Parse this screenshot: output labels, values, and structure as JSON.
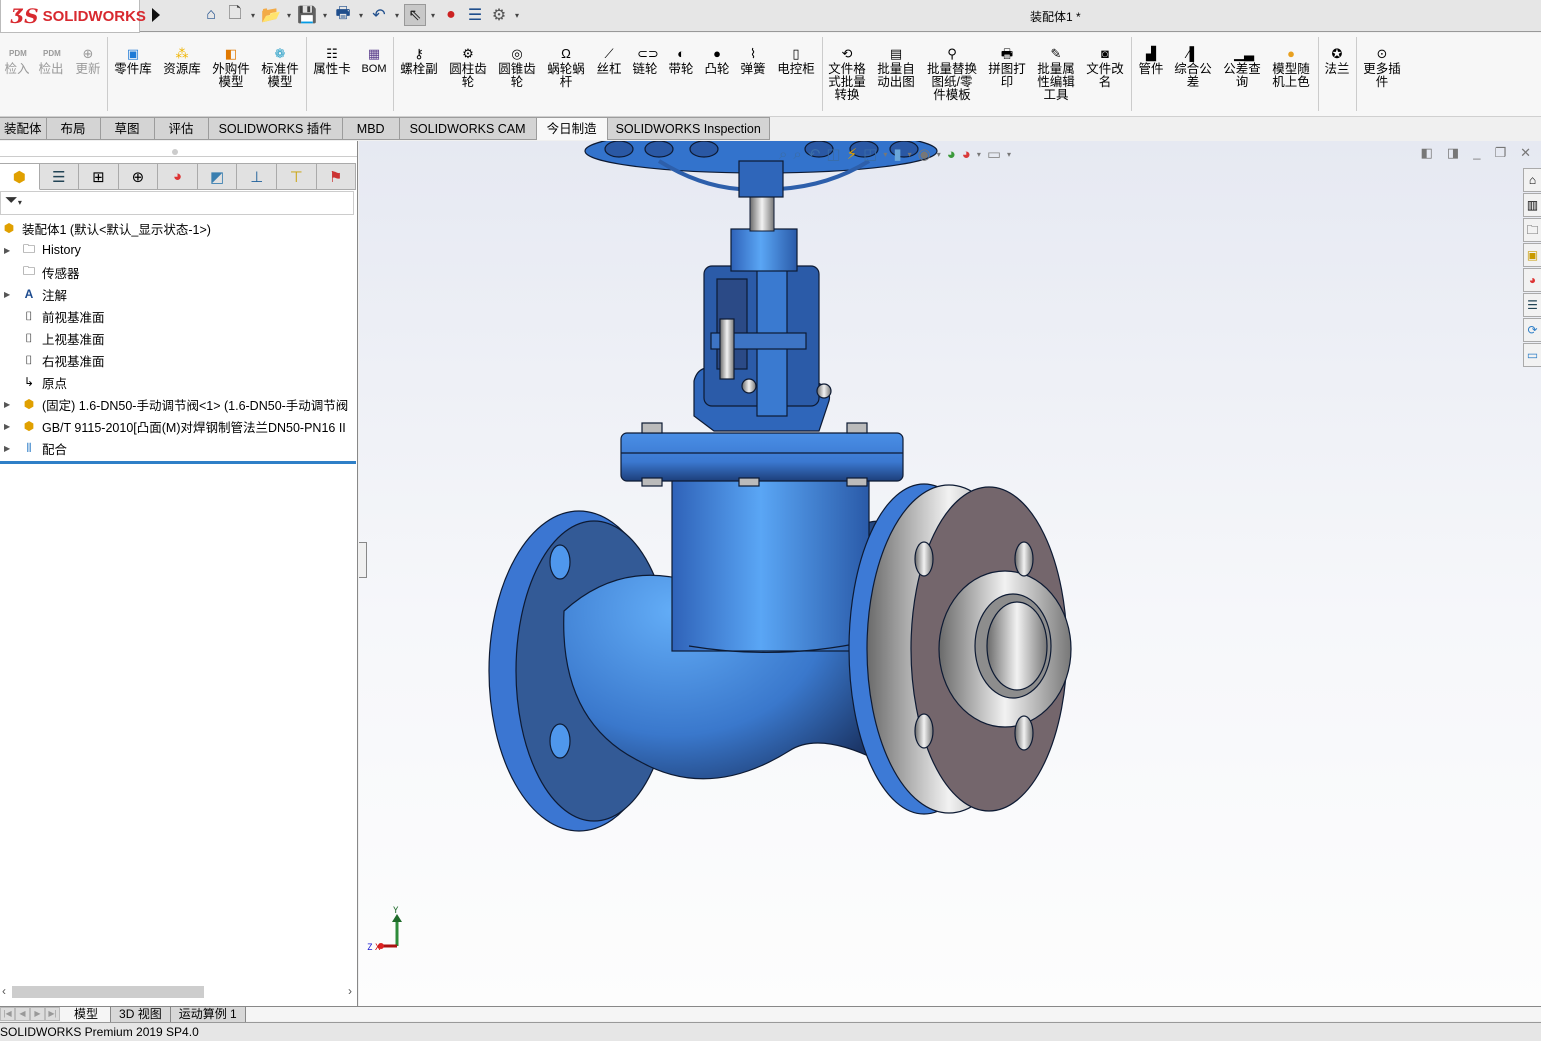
{
  "app": {
    "brand": "SOLIDWORKS",
    "brand_prefix": "3S",
    "document_title": "装配体1 *"
  },
  "quick_access": [
    {
      "icon": "home-icon"
    },
    {
      "icon": "new-document-icon"
    },
    {
      "icon": "open-icon"
    },
    {
      "icon": "save-icon"
    },
    {
      "icon": "print-icon"
    },
    {
      "icon": "undo-icon"
    },
    {
      "icon": "select-arrow-icon"
    },
    {
      "icon": "rebuild-traffic-light-icon"
    },
    {
      "icon": "file-properties-icon"
    },
    {
      "icon": "options-gear-icon"
    }
  ],
  "command_manager": {
    "pdm": [
      {
        "label": "检入",
        "icon": "pdm-checkin-icon",
        "disabled": true
      },
      {
        "label": "检出",
        "icon": "pdm-checkout-icon",
        "disabled": true
      },
      {
        "label": "更新",
        "icon": "pdm-update-icon",
        "disabled": true
      }
    ],
    "library": [
      {
        "label": "零件库",
        "icon": "part-library-icon"
      },
      {
        "label": "资源库",
        "icon": "resource-library-icon"
      },
      {
        "label": "外购件\n模型",
        "icon": "purchased-part-icon"
      },
      {
        "label": "标准件\n模型",
        "icon": "standard-part-icon"
      }
    ],
    "props": [
      {
        "label": "属性卡",
        "icon": "property-card-icon"
      },
      {
        "label": "BOM",
        "icon": "bom-icon"
      }
    ],
    "mechanical": [
      {
        "label": "螺栓副",
        "icon": "bolt-icon"
      },
      {
        "label": "圆柱齿\n轮",
        "icon": "spur-gear-icon"
      },
      {
        "label": "圆锥齿\n轮",
        "icon": "bevel-gear-icon"
      },
      {
        "label": "蜗轮蜗\n杆",
        "icon": "worm-gear-icon"
      },
      {
        "label": "丝杠",
        "icon": "lead-screw-icon"
      },
      {
        "label": "链轮",
        "icon": "sprocket-icon"
      },
      {
        "label": "带轮",
        "icon": "pulley-icon"
      },
      {
        "label": "凸轮",
        "icon": "cam-icon"
      },
      {
        "label": "弹簧",
        "icon": "spring-icon"
      },
      {
        "label": "电控柜",
        "icon": "control-cabinet-icon"
      }
    ],
    "batch": [
      {
        "label": "文件格\n式批量\n转换",
        "icon": "format-convert-icon"
      },
      {
        "label": "批量自\n动出图",
        "icon": "auto-drawing-icon"
      },
      {
        "label": "批量替换\n图纸/零\n件模板",
        "icon": "replace-template-icon"
      },
      {
        "label": "拼图打\n印",
        "icon": "print-tile-icon"
      },
      {
        "label": "批量属\n性编辑\n工具",
        "icon": "batch-property-edit-icon"
      },
      {
        "label": "文件改\n名",
        "icon": "file-rename-icon"
      }
    ],
    "tools": [
      {
        "label": "管件",
        "icon": "pipe-fitting-icon"
      },
      {
        "label": "综合公\n差",
        "icon": "tolerance-icon"
      },
      {
        "label": "公差查\n询",
        "icon": "tolerance-lookup-icon"
      },
      {
        "label": "模型随\n机上色",
        "icon": "random-color-icon"
      }
    ],
    "flange": [
      {
        "label": "法兰",
        "icon": "flange-icon"
      }
    ],
    "more": [
      {
        "label": "更多插\n件",
        "icon": "more-plugins-icon"
      }
    ]
  },
  "tabs": [
    {
      "label": "装配体",
      "active": false
    },
    {
      "label": "布局",
      "active": false
    },
    {
      "label": "草图",
      "active": false
    },
    {
      "label": "评估",
      "active": false
    },
    {
      "label": "SOLIDWORKS 插件",
      "active": false
    },
    {
      "label": "MBD",
      "active": false
    },
    {
      "label": "SOLIDWORKS CAM",
      "active": false
    },
    {
      "label": "今日制造",
      "active": true
    },
    {
      "label": "SOLIDWORKS Inspection",
      "active": false
    }
  ],
  "manager_tabs": [
    {
      "icon": "featuremanager-icon",
      "active": true
    },
    {
      "icon": "propertymanager-icon"
    },
    {
      "icon": "configurationmanager-icon"
    },
    {
      "icon": "dimxpertmanager-icon"
    },
    {
      "icon": "displaymanager-icon"
    },
    {
      "icon": "cam-feature-tree-icon"
    },
    {
      "icon": "cam-operation-tree-icon"
    },
    {
      "icon": "cam-tool-tree-icon"
    },
    {
      "icon": "inspection-icon"
    }
  ],
  "feature_tree": {
    "root": "装配体1  (默认<默认_显示状态-1>)",
    "items": [
      {
        "label": "History",
        "icon": "history-folder-icon",
        "expandable": true
      },
      {
        "label": "传感器",
        "icon": "sensor-folder-icon",
        "expandable": false
      },
      {
        "label": "注解",
        "icon": "annotations-folder-icon",
        "expandable": true
      },
      {
        "label": "前视基准面",
        "icon": "plane-icon",
        "expandable": false
      },
      {
        "label": "上视基准面",
        "icon": "plane-icon",
        "expandable": false
      },
      {
        "label": "右视基准面",
        "icon": "plane-icon",
        "expandable": false
      },
      {
        "label": "原点",
        "icon": "origin-icon",
        "expandable": false
      },
      {
        "label": "(固定) 1.6-DN50-手动调节阀<1> (1.6-DN50-手动调节阀",
        "icon": "subassembly-icon",
        "expandable": true
      },
      {
        "label": "GB/T 9115-2010[凸面(M)对焊钢制管法兰DN50-PN16 II",
        "icon": "subassembly-icon",
        "expandable": true
      },
      {
        "label": "配合",
        "icon": "mates-icon",
        "expandable": true
      }
    ]
  },
  "view_toolbar": [
    {
      "icon": "zoom-to-fit-icon"
    },
    {
      "icon": "zoom-to-area-icon"
    },
    {
      "icon": "previous-view-icon"
    },
    {
      "icon": "section-view-icon"
    },
    {
      "icon": "dynamic-annotation-icon"
    },
    {
      "icon": "view-orientation-icon"
    },
    {
      "icon": "display-style-icon"
    },
    {
      "icon": "hide-show-items-icon"
    },
    {
      "icon": "edit-appearance-icon"
    },
    {
      "icon": "apply-scene-icon"
    },
    {
      "icon": "view-settings-icon"
    }
  ],
  "task_pane": [
    {
      "icon": "solidworks-resources-icon"
    },
    {
      "icon": "design-library-icon"
    },
    {
      "icon": "file-explorer-icon"
    },
    {
      "icon": "view-palette-icon"
    },
    {
      "icon": "appearances-icon"
    },
    {
      "icon": "custom-properties-icon"
    },
    {
      "icon": "solidworks-forum-icon"
    },
    {
      "icon": "comments-icon"
    }
  ],
  "triad": {
    "x": "X",
    "y": "Y",
    "z": "Z"
  },
  "bottom_tabs": [
    {
      "label": "模型",
      "active": true
    },
    {
      "label": "3D 视图",
      "active": false
    },
    {
      "label": "运动算例 1",
      "active": false
    }
  ],
  "status_bar": {
    "text": "SOLIDWORKS Premium 2019 SP4.0"
  },
  "colors": {
    "valve_blue": "#3f7fd6",
    "flange_face": "#74666c",
    "accent_blue": "#2f7fc7",
    "brand_red": "#d8292f"
  }
}
